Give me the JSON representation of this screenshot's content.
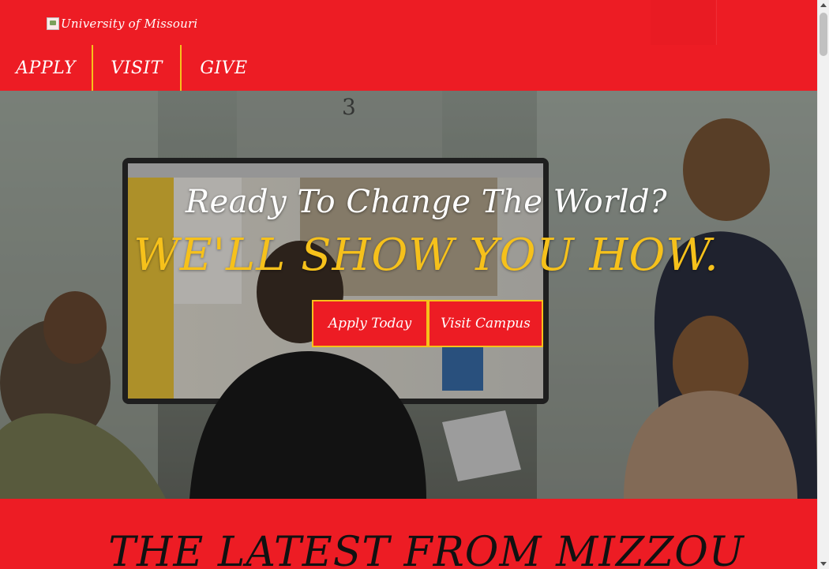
{
  "header": {
    "logo_alt": "University of Missouri"
  },
  "nav": {
    "apply": "APPLY",
    "visit": "VISIT",
    "give": "GIVE"
  },
  "hero": {
    "kicker": "Ready To Change The World?",
    "headline": "WE'LL SHOW YOU HOW.",
    "apply_button": "Apply Today",
    "visit_button": "Visit Campus"
  },
  "latest": {
    "title": "THE LATEST FROM MIZZOU"
  },
  "colors": {
    "brand_red": "#ed1c24",
    "gold": "#f6c11b",
    "white": "#ffffff",
    "dark_text": "#111111"
  }
}
